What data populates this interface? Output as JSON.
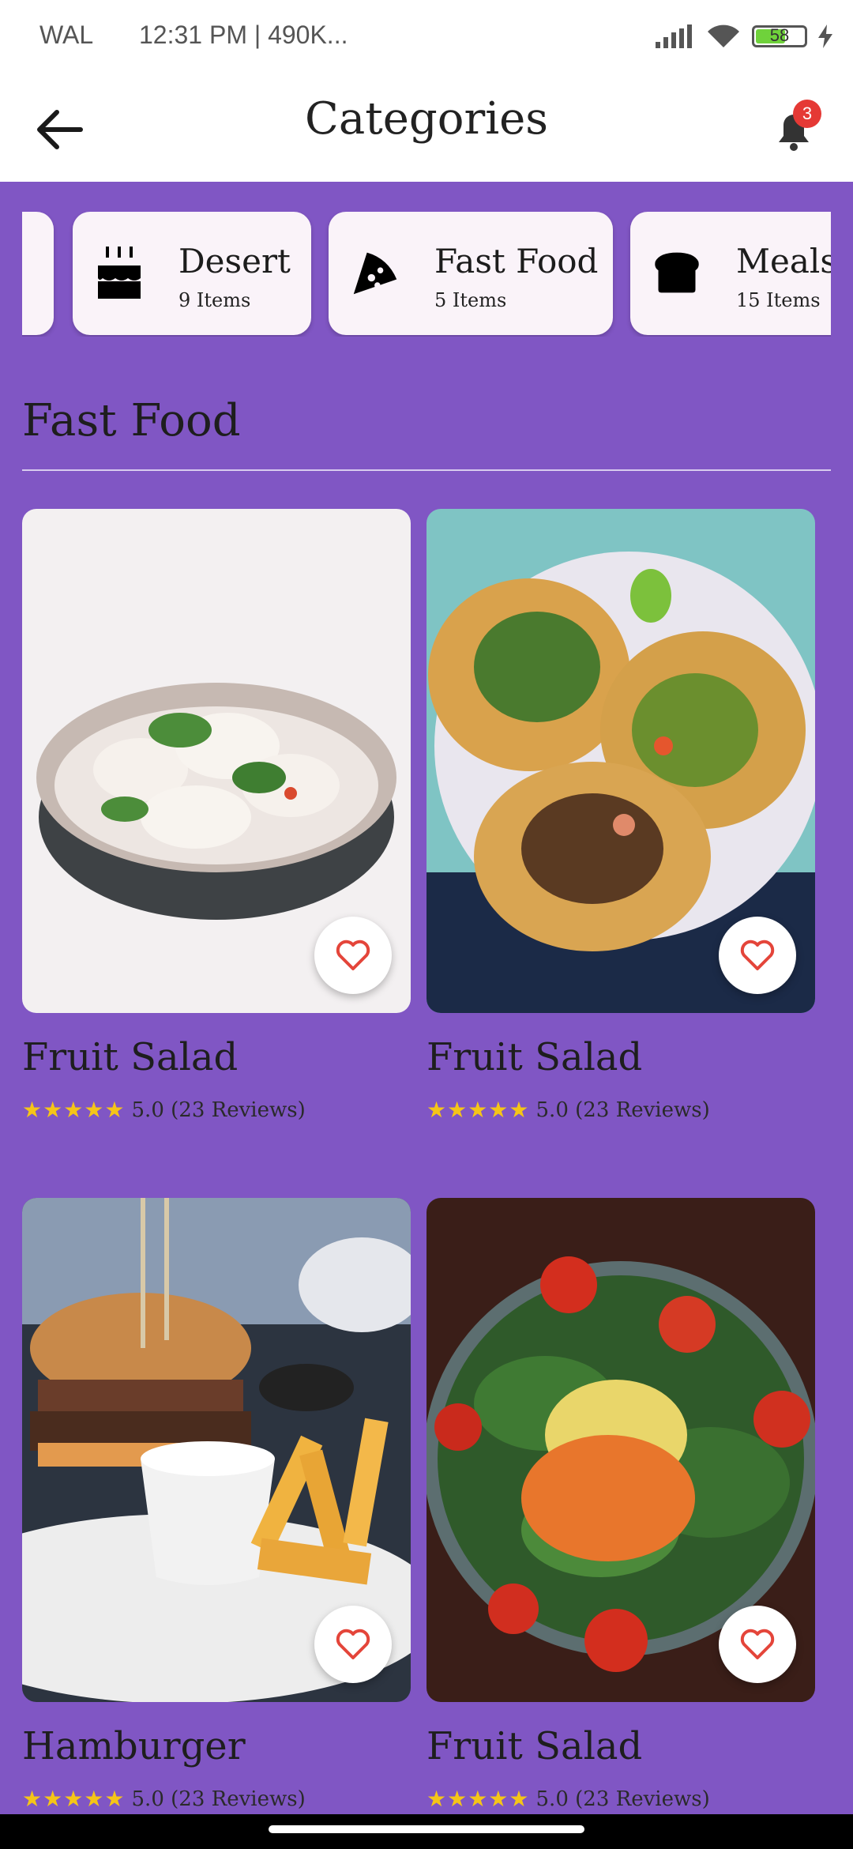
{
  "status_bar": {
    "left_text": "WAL",
    "time_text": "12:31 PM | 490K...",
    "battery_level": "58"
  },
  "header": {
    "title": "Categories",
    "notification_count": "3"
  },
  "categories": [
    {
      "name": "Desert",
      "count": "9 Items",
      "icon": "cake-icon"
    },
    {
      "name": "Fast Food",
      "count": "5 Items",
      "icon": "pizza-slice-icon"
    },
    {
      "name": "Meals",
      "count": "15 Items",
      "icon": "bread-icon"
    }
  ],
  "section": {
    "title": "Fast Food"
  },
  "products": [
    {
      "name": "Fruit Salad",
      "stars": "★★★★★",
      "rating": "5.0 (23 Reviews)",
      "image": "dumplings-bowl"
    },
    {
      "name": "Fruit Salad",
      "stars": "★★★★★",
      "rating": "5.0 (23 Reviews)",
      "image": "tacos-plate"
    },
    {
      "name": "Hamburger",
      "stars": "★★★★★",
      "rating": "5.0 (23 Reviews)",
      "image": "burger-fries"
    },
    {
      "name": "Fruit Salad",
      "stars": "★★★★★",
      "rating": "5.0 (23 Reviews)",
      "image": "green-salad-bowl"
    }
  ],
  "colors": {
    "background": "#8056C4",
    "chip": "#FAF3F9",
    "star": "#F5C518",
    "heart": "#E4453A",
    "badge": "#E53935"
  }
}
